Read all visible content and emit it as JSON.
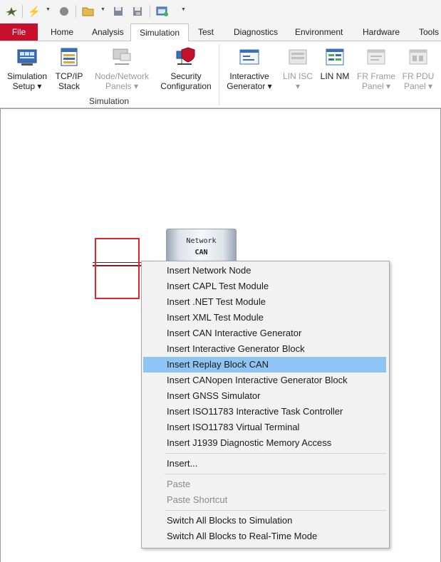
{
  "quick_access": {
    "icons": [
      "app-logo-icon",
      "lightning-icon",
      "record-icon",
      "open-folder-icon",
      "save-icon",
      "save-as-icon",
      "config-icon"
    ]
  },
  "tabs": [
    {
      "label": "File"
    },
    {
      "label": "Home"
    },
    {
      "label": "Analysis"
    },
    {
      "label": "Simulation"
    },
    {
      "label": "Test"
    },
    {
      "label": "Diagnostics"
    },
    {
      "label": "Environment"
    },
    {
      "label": "Hardware"
    },
    {
      "label": "Tools"
    }
  ],
  "ribbon": {
    "group_label": "Simulation",
    "buttons": [
      {
        "line1": "Simulation",
        "line2": "Setup ▾"
      },
      {
        "line1": "TCP/IP",
        "line2": "Stack"
      },
      {
        "line1": "Node/Network",
        "line2": "Panels ▾"
      },
      {
        "line1": "Security",
        "line2": "Configuration"
      },
      {
        "line1": "Interactive",
        "line2": "Generator ▾"
      },
      {
        "line1": "LIN ISC",
        "line2": "▾"
      },
      {
        "line1": "LIN NM",
        "line2": ""
      },
      {
        "line1": "FR Frame",
        "line2": "Panel ▾"
      },
      {
        "line1": "FR PDU",
        "line2": "Panel ▾"
      }
    ]
  },
  "canvas": {
    "network_block": {
      "line1": "Network",
      "line2": "CAN"
    }
  },
  "context_menu": {
    "items": [
      {
        "label": "Insert Network Node"
      },
      {
        "label": "Insert CAPL Test Module"
      },
      {
        "label": "Insert .NET Test Module"
      },
      {
        "label": "Insert XML Test Module"
      },
      {
        "label": "Insert CAN Interactive Generator"
      },
      {
        "label": "Insert Interactive Generator Block"
      },
      {
        "label": "Insert Replay Block CAN"
      },
      {
        "label": "Insert CANopen Interactive Generator Block"
      },
      {
        "label": "Insert GNSS Simulator"
      },
      {
        "label": "Insert ISO11783 Interactive Task Controller"
      },
      {
        "label": "Insert ISO11783 Virtual Terminal"
      },
      {
        "label": "Insert J1939 Diagnostic Memory Access"
      },
      {
        "label": "Insert..."
      },
      {
        "label": "Paste"
      },
      {
        "label": "Paste Shortcut"
      },
      {
        "label": "Switch All Blocks to Simulation"
      },
      {
        "label": "Switch All Blocks to Real-Time Mode"
      }
    ],
    "highlighted": "Insert Replay Block CAN"
  },
  "colors": {
    "file_tab": "#c8102e",
    "menu_highlight": "#8ec5f3",
    "selection_box": "#e0252b"
  }
}
